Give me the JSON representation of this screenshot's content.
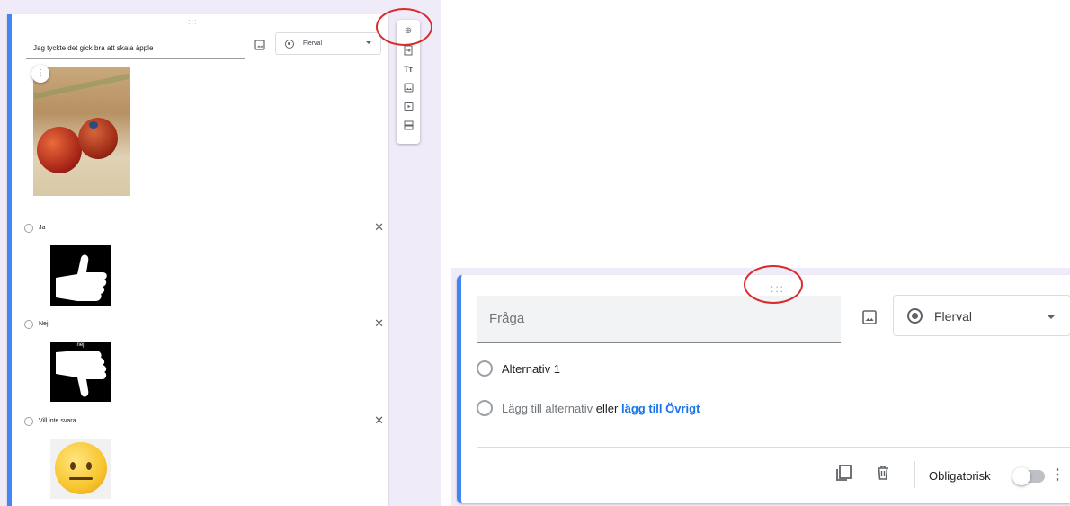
{
  "left": {
    "question_text": "Jag tyckte det gick bra att skala äpple",
    "type_label": "Flerval",
    "options": [
      {
        "label": "Ja"
      },
      {
        "label": "Nej",
        "image_caption": "nej"
      },
      {
        "label": "Vill inte svara"
      }
    ],
    "toolbar_icons": [
      "add-circle-icon",
      "import-icon",
      "title-icon",
      "image-icon",
      "video-icon",
      "section-icon"
    ],
    "drag_handle": ":::"
  },
  "right": {
    "question_placeholder": "Fråga",
    "type_label": "Flerval",
    "option_1": "Alternativ 1",
    "add_option": "Lägg till alternativ",
    "or_text": "eller",
    "add_other": "lägg till Övrigt",
    "required_label": "Obligatorisk",
    "drag_handle": ":::"
  },
  "colors": {
    "accent": "#4285f4",
    "annotation_circle": "#d92b2b",
    "link": "#1a73e8",
    "panel_bg": "#f0ebf8"
  }
}
